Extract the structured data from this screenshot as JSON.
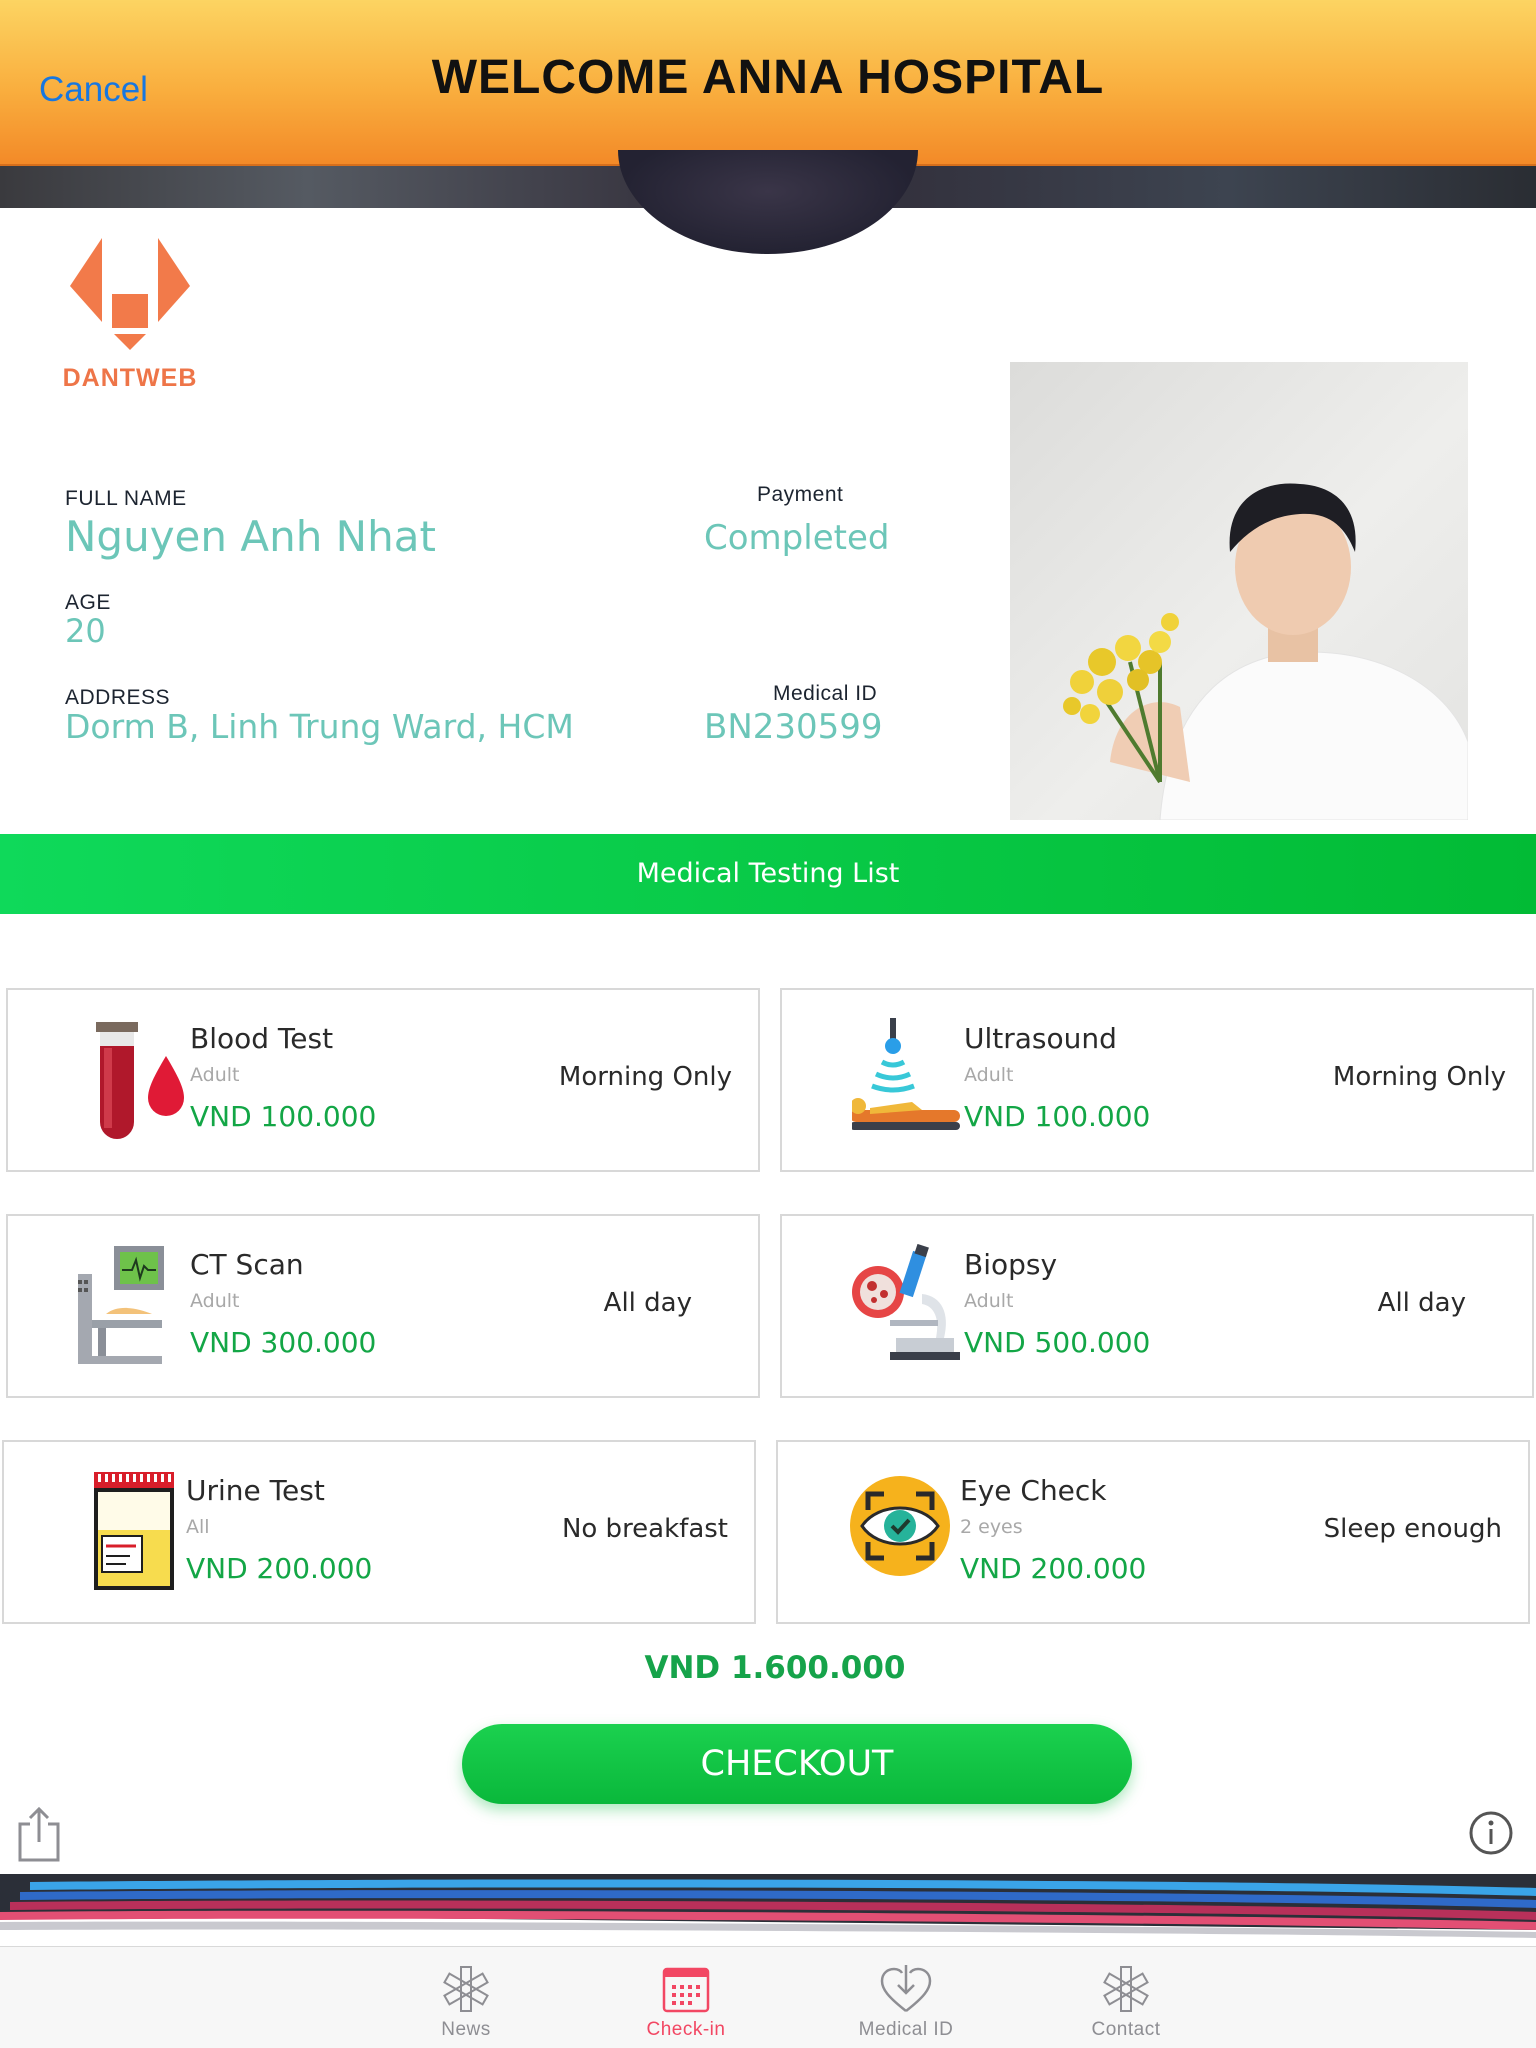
{
  "header": {
    "cancel_label": "Cancel",
    "title": "WELCOME ANNA HOSPITAL"
  },
  "logo": {
    "text": "DANTWEB"
  },
  "patient": {
    "full_name_label": "FULL NAME",
    "full_name": "Nguyen Anh Nhat",
    "age_label": "AGE",
    "age": "20",
    "address_label": "ADDRESS",
    "address": "Dorm B, Linh Trung Ward, HCM",
    "payment_label": "Payment",
    "payment": "Completed",
    "medical_id_label": "Medical ID",
    "medical_id": "BN230599"
  },
  "testing_list": {
    "title": "Medical Testing List",
    "items": [
      {
        "name": "Blood Test",
        "group": "Adult",
        "price": "VND 100.000",
        "note": "Morning Only",
        "icon": "blood-tube-icon"
      },
      {
        "name": "Ultrasound",
        "group": "Adult",
        "price": "VND 100.000",
        "note": "Morning Only",
        "icon": "ultrasound-icon"
      },
      {
        "name": "CT Scan",
        "group": "Adult",
        "price": "VND 300.000",
        "note": "All day",
        "icon": "ct-scanner-icon"
      },
      {
        "name": "Biopsy",
        "group": "Adult",
        "price": "VND 500.000",
        "note": "All day",
        "icon": "microscope-icon"
      },
      {
        "name": "Urine Test",
        "group": "All",
        "price": "VND 200.000",
        "note": "No breakfast",
        "icon": "urine-cup-icon"
      },
      {
        "name": "Eye Check",
        "group": "2 eyes",
        "price": "VND 200.000",
        "note": "Sleep enough",
        "icon": "eye-icon"
      }
    ]
  },
  "total": "VND 1.600.000",
  "checkout_label": "CHECKOUT",
  "tabbar": {
    "tabs": [
      {
        "label": "News",
        "icon": "star-of-life-icon"
      },
      {
        "label": "Check-in",
        "icon": "calendar-icon"
      },
      {
        "label": "Medical ID",
        "icon": "heart-download-icon"
      },
      {
        "label": "Contact",
        "icon": "star-of-life-icon"
      }
    ],
    "active": "Check-in"
  },
  "colors": {
    "accent_green": "#13a646",
    "value_teal": "#6cc6b8",
    "active_tab": "#f24763",
    "header_orange": "#f9ae3e"
  }
}
